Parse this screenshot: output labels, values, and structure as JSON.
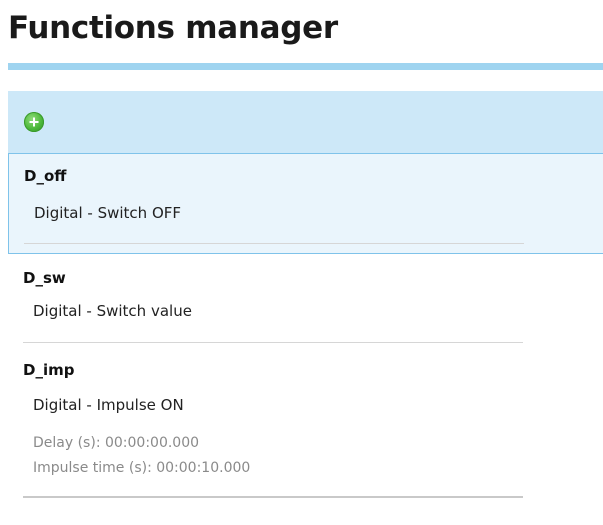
{
  "page": {
    "title": "Functions manager"
  },
  "toolbar": {
    "add_icon": "add-circle-icon",
    "accent_color": "#cde8f8",
    "underline_color": "#9fd4f0"
  },
  "functions": [
    {
      "name": "D_off",
      "type": "Digital - Switch OFF",
      "selected": true
    },
    {
      "name": "D_sw",
      "type": "Digital - Switch value",
      "selected": false
    },
    {
      "name": "D_imp",
      "type": "Digital - Impulse ON",
      "selected": false,
      "params": [
        "Delay (s): 00:00:00.000",
        "Impulse time (s): 00:00:10.000"
      ]
    }
  ]
}
